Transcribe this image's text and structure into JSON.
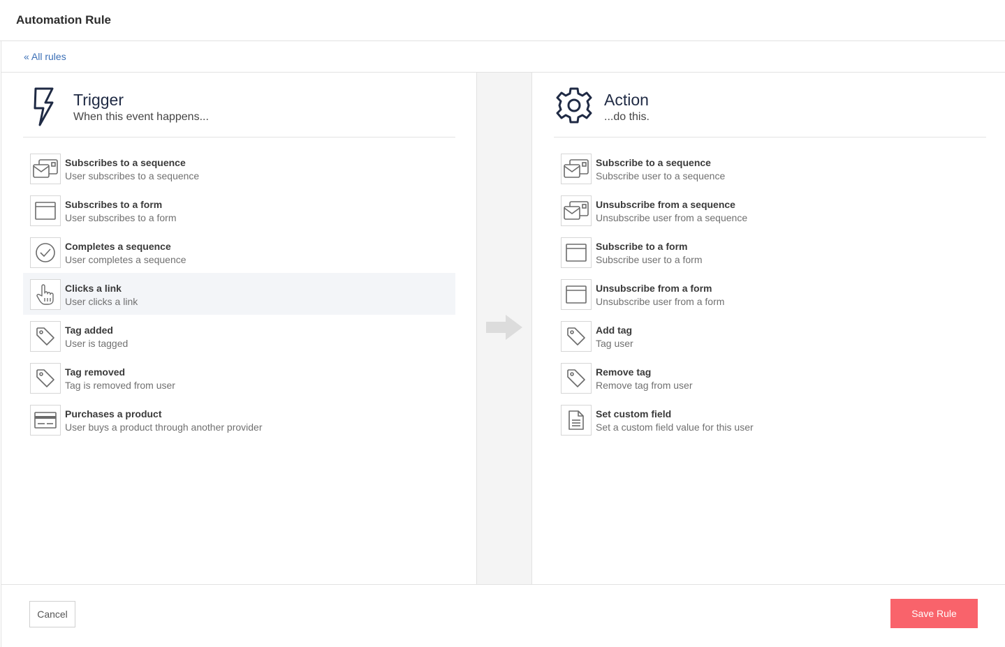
{
  "app": {
    "title": "Automation Rule"
  },
  "breadcrumb": {
    "back_label": "« All rules"
  },
  "trigger": {
    "title": "Trigger",
    "subtitle": "When this event happens...",
    "items": [
      {
        "title": "Subscribes to a sequence",
        "desc": "User subscribes to a sequence",
        "icon": "sequence-icon"
      },
      {
        "title": "Subscribes to a form",
        "desc": "User subscribes to a form",
        "icon": "form-icon"
      },
      {
        "title": "Completes a sequence",
        "desc": "User completes a sequence",
        "icon": "check-circle-icon"
      },
      {
        "title": "Clicks a link",
        "desc": "User clicks a link",
        "icon": "pointer-hand-icon"
      },
      {
        "title": "Tag added",
        "desc": "User is tagged",
        "icon": "tag-icon"
      },
      {
        "title": "Tag removed",
        "desc": "Tag is removed from user",
        "icon": "tag-icon"
      },
      {
        "title": "Purchases a product",
        "desc": "User buys a product through another provider",
        "icon": "credit-card-icon"
      }
    ]
  },
  "action": {
    "title": "Action",
    "subtitle": "...do this.",
    "items": [
      {
        "title": "Subscribe to a sequence",
        "desc": "Subscribe user to a sequence",
        "icon": "sequence-icon"
      },
      {
        "title": "Unsubscribe from a sequence",
        "desc": "Unsubscribe user from a sequence",
        "icon": "sequence-icon"
      },
      {
        "title": "Subscribe to a form",
        "desc": "Subscribe user to a form",
        "icon": "form-icon"
      },
      {
        "title": "Unsubscribe from a form",
        "desc": "Unsubscribe user from a form",
        "icon": "form-icon"
      },
      {
        "title": "Add tag",
        "desc": "Tag user",
        "icon": "tag-icon"
      },
      {
        "title": "Remove tag",
        "desc": "Remove tag from user",
        "icon": "tag-icon"
      },
      {
        "title": "Set custom field",
        "desc": "Set a custom field value for this user",
        "icon": "document-icon"
      }
    ]
  },
  "footer": {
    "cancel_label": "Cancel",
    "save_label": "Save Rule"
  },
  "colors": {
    "accent": "#f9636b",
    "link": "#3b6fb6",
    "heading": "#1f2a44"
  }
}
